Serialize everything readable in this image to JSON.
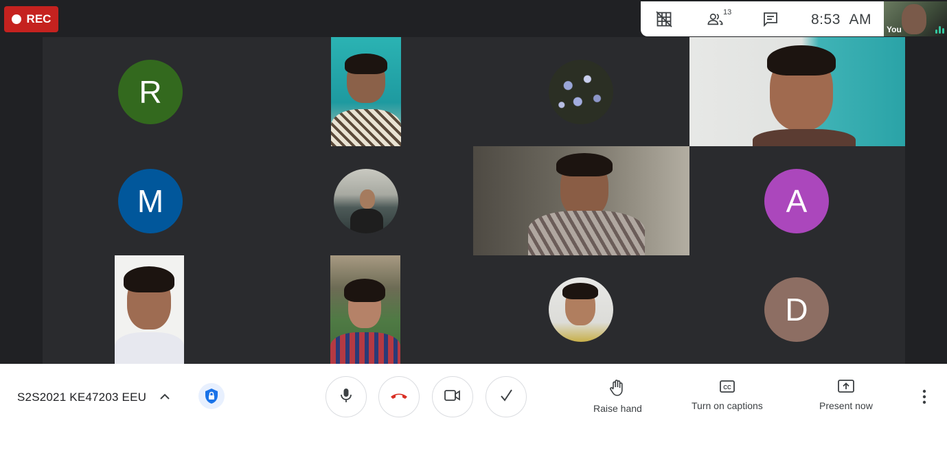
{
  "recording": {
    "label": "REC"
  },
  "topbar": {
    "participants_count": "13",
    "time": "8:53",
    "ampm": "AM",
    "icons": [
      "grid-off-icon",
      "people-icon",
      "chat-icon"
    ]
  },
  "self_view": {
    "label": "You"
  },
  "participants": {
    "avatars": [
      {
        "initial": "R",
        "color": "#33691e"
      },
      {
        "initial": "M",
        "color": "#01579b"
      },
      {
        "initial": "A",
        "color": "#ab47bc"
      },
      {
        "initial": "D",
        "color": "#8d6e63"
      }
    ]
  },
  "controls": {
    "meeting_title": "S2S2021 KE47203 EEU",
    "raise_hand": "Raise hand",
    "captions": "Turn on captions",
    "present": "Present now"
  },
  "colors": {
    "end_call": "#d93025",
    "accent": "#1a73e8",
    "rec": "#c5221f"
  }
}
